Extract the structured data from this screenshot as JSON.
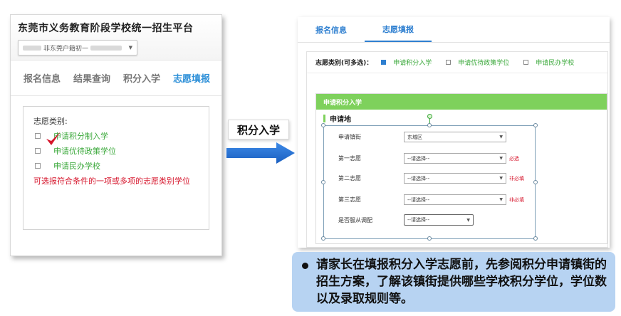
{
  "left": {
    "platform_title": "东莞市义务教育阶段学校统一招生平台",
    "user_select_value": "非东莞户籍初一",
    "tabs": [
      "报名信息",
      "结果查询",
      "积分入学",
      "志愿填报"
    ],
    "active_tab": "志愿填报",
    "wish_label": "志愿类别:",
    "wish_options": [
      "申请积分制入学",
      "申请优待政策学位",
      "申请民办学校"
    ],
    "note": "可选报符合条件的一项或多项的志愿类别学位",
    "colors": {
      "accent": "#2c8fd8",
      "option_green": "#3aa83a",
      "note_red": "#d6162c",
      "check_red": "#d6162c"
    }
  },
  "arrow": {
    "label": "积分入学",
    "color": "#1f6fd0"
  },
  "right": {
    "tabs": [
      "报名信息",
      "志愿填报"
    ],
    "type_label": "志愿类别(可多选)：",
    "type_options": [
      {
        "label": "申请积分入学",
        "checked": true
      },
      {
        "label": "申请优待政策学位",
        "checked": false
      },
      {
        "label": "申请民办学校",
        "checked": false
      }
    ],
    "section_title": "申请积分入学",
    "apply_location": "申请地",
    "form": {
      "street_label": "申请镇街",
      "street_value": "东城区",
      "first_label": "第一志愿",
      "first_value": "--请选择--",
      "first_note": "必选",
      "second_label": "第二志愿",
      "second_value": "--请选择--",
      "second_note": "非必填",
      "third_label": "第三志愿",
      "third_value": "--请选择--",
      "third_note": "非必填",
      "adjust_label": "是否服从调配",
      "adjust_value": "--请选择--"
    },
    "colors": {
      "tab_blue": "#2e7fd0",
      "section_green": "#7ed15c"
    }
  },
  "callout": {
    "text": "请家长在填报积分入学志愿前，先参阅积分申请镇街的招生方案，了解该镇街提供哪些学校积分学位，学位数以及录取规则等。",
    "background": "#b7d3f2"
  }
}
